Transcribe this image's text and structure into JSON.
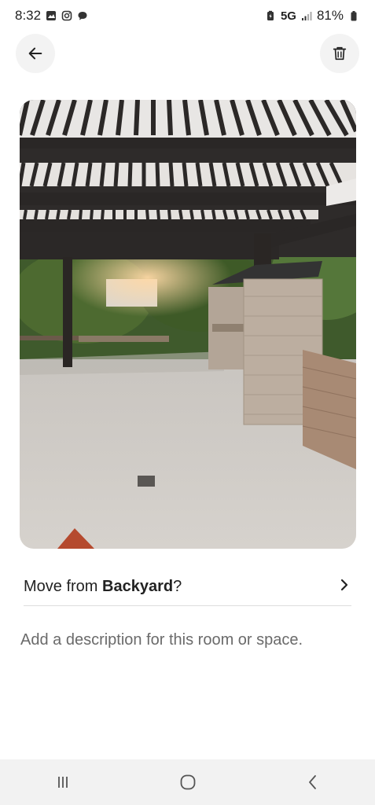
{
  "status_bar": {
    "time": "8:32",
    "left_icons": [
      "gallery-icon",
      "instagram-icon",
      "chat-bubble-icon"
    ],
    "network": "5G",
    "battery": "81%"
  },
  "header": {
    "back_icon": "arrow-left-icon",
    "delete_icon": "trash-icon"
  },
  "photo": {
    "subject": "backyard-pergola-photo"
  },
  "move_row": {
    "prefix": "Move from ",
    "room": "Backyard",
    "suffix": "?"
  },
  "description": {
    "placeholder": "Add a description for this room or space."
  },
  "nav_bar": {
    "buttons": [
      "recent-apps-icon",
      "home-icon",
      "back-icon"
    ]
  }
}
